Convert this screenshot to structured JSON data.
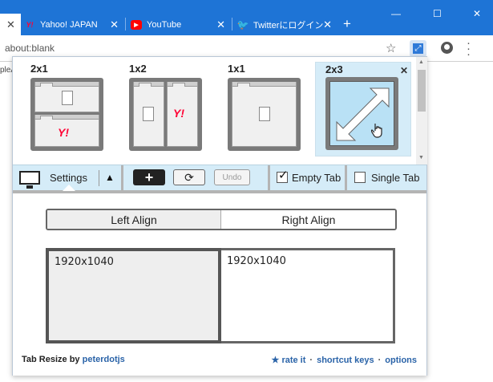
{
  "browser": {
    "tabs": [
      {
        "label": "Yahoo! JAPAN",
        "favicon": "yahoo-icon"
      },
      {
        "label": "YouTube",
        "favicon": "youtube-icon"
      },
      {
        "label": "Twitterにログイン",
        "favicon": "twitter-icon"
      }
    ],
    "new_tab": "+",
    "address": "about:blank",
    "bookmark_fragment": "pleA"
  },
  "layouts": [
    {
      "label": "2x1",
      "selected": false
    },
    {
      "label": "1x2",
      "selected": false
    },
    {
      "label": "1x1",
      "selected": false
    },
    {
      "label": "2x3",
      "selected": true
    }
  ],
  "toolbar": {
    "settings_label": "Settings",
    "undo_label": "Undo",
    "empty_tab_label": "Empty Tab",
    "empty_tab_checked": true,
    "single_tab_label": "Single Tab",
    "single_tab_checked": false
  },
  "settings": {
    "left_align_label": "Left Align",
    "right_align_label": "Right Align",
    "selected_align": "left",
    "displays": [
      {
        "resolution": "1920x1040",
        "selected": true
      },
      {
        "resolution": "1920x1040",
        "selected": false
      }
    ]
  },
  "footer": {
    "title": "Tab Resize by ",
    "author": "peterdotjs",
    "rate_label": "★ rate it",
    "shortcut_label": "shortcut keys",
    "options_label": "options",
    "separator": "·"
  },
  "colors": {
    "titlebar": "#1e74d6",
    "selected_layout": "#d5ecf8",
    "link": "#2a63a8"
  }
}
